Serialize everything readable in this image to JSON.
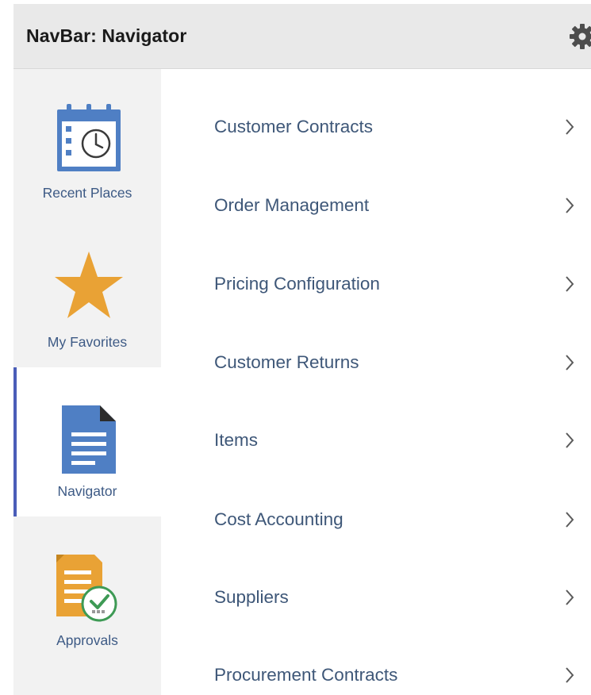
{
  "header": {
    "title": "NavBar: Navigator",
    "settings_icon": "gear-icon"
  },
  "sidebar": {
    "active_index": 2,
    "accent_color": "#4a5db8",
    "items": [
      {
        "label": "Recent Places",
        "icon": "recent-places-calendar-clock-icon"
      },
      {
        "label": "My Favorites",
        "icon": "star-icon"
      },
      {
        "label": "Navigator",
        "icon": "document-icon"
      },
      {
        "label": "Approvals",
        "icon": "approvals-document-check-icon"
      }
    ]
  },
  "navigator": {
    "chevron_icon": "chevron-right-icon",
    "items": [
      {
        "label": "Customer Contracts"
      },
      {
        "label": "Order Management"
      },
      {
        "label": "Pricing Configuration"
      },
      {
        "label": "Customer Returns"
      },
      {
        "label": "Items"
      },
      {
        "label": "Cost Accounting"
      },
      {
        "label": "Suppliers"
      },
      {
        "label": "Procurement Contracts"
      }
    ]
  }
}
